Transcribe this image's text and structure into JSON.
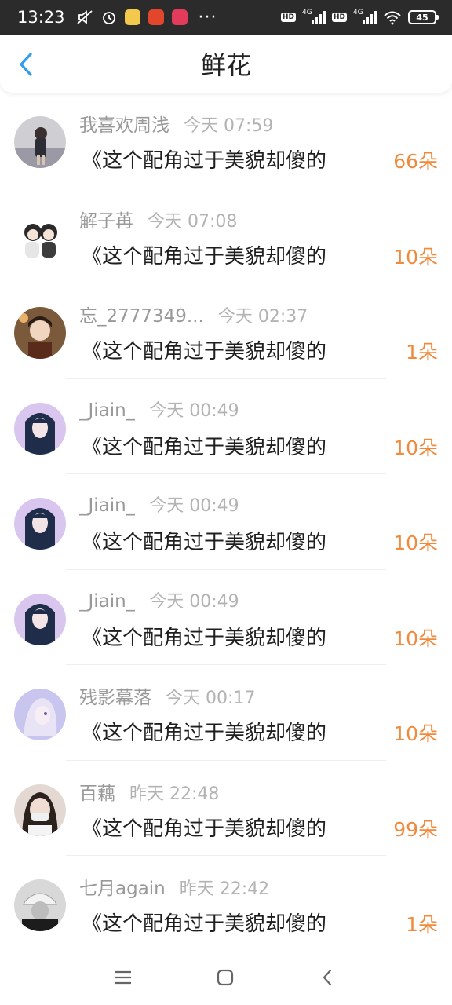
{
  "status_bar": {
    "time": "13:23",
    "hd_label": "HD",
    "net_label": "4G",
    "battery": "45",
    "dots": "···"
  },
  "header": {
    "title": "鲜花",
    "back_icon": "chevron-left-icon"
  },
  "colors": {
    "accent_back": "#2f9df1",
    "flower_count": "#f08a3c",
    "meta_text": "#999999"
  },
  "list": [
    {
      "user": "我喜欢周浅",
      "time": "今天 07:59",
      "book": "《这个配角过于美貌却傻的",
      "count": "66朵"
    },
    {
      "user": "解子苒",
      "time": "今天 07:08",
      "book": "《这个配角过于美貌却傻的",
      "count": "10朵"
    },
    {
      "user": "忘_2777349...",
      "time": "今天 02:37",
      "book": "《这个配角过于美貌却傻的",
      "count": "1朵"
    },
    {
      "user": "_Jiain_",
      "time": "今天 00:49",
      "book": "《这个配角过于美貌却傻的",
      "count": "10朵"
    },
    {
      "user": "_Jiain_",
      "time": "今天 00:49",
      "book": "《这个配角过于美貌却傻的",
      "count": "10朵"
    },
    {
      "user": "_Jiain_",
      "time": "今天 00:49",
      "book": "《这个配角过于美貌却傻的",
      "count": "10朵"
    },
    {
      "user": "残影幕落",
      "time": "今天 00:17",
      "book": "《这个配角过于美貌却傻的",
      "count": "10朵"
    },
    {
      "user": "百藕",
      "time": "昨天 22:48",
      "book": "《这个配角过于美貌却傻的",
      "count": "99朵"
    },
    {
      "user": "七月again",
      "time": "昨天 22:42",
      "book": "《这个配角过于美貌却傻的",
      "count": "1朵"
    }
  ],
  "nav": {
    "menu_icon": "menu-icon",
    "home_icon": "home-icon",
    "back_icon": "back-icon"
  }
}
